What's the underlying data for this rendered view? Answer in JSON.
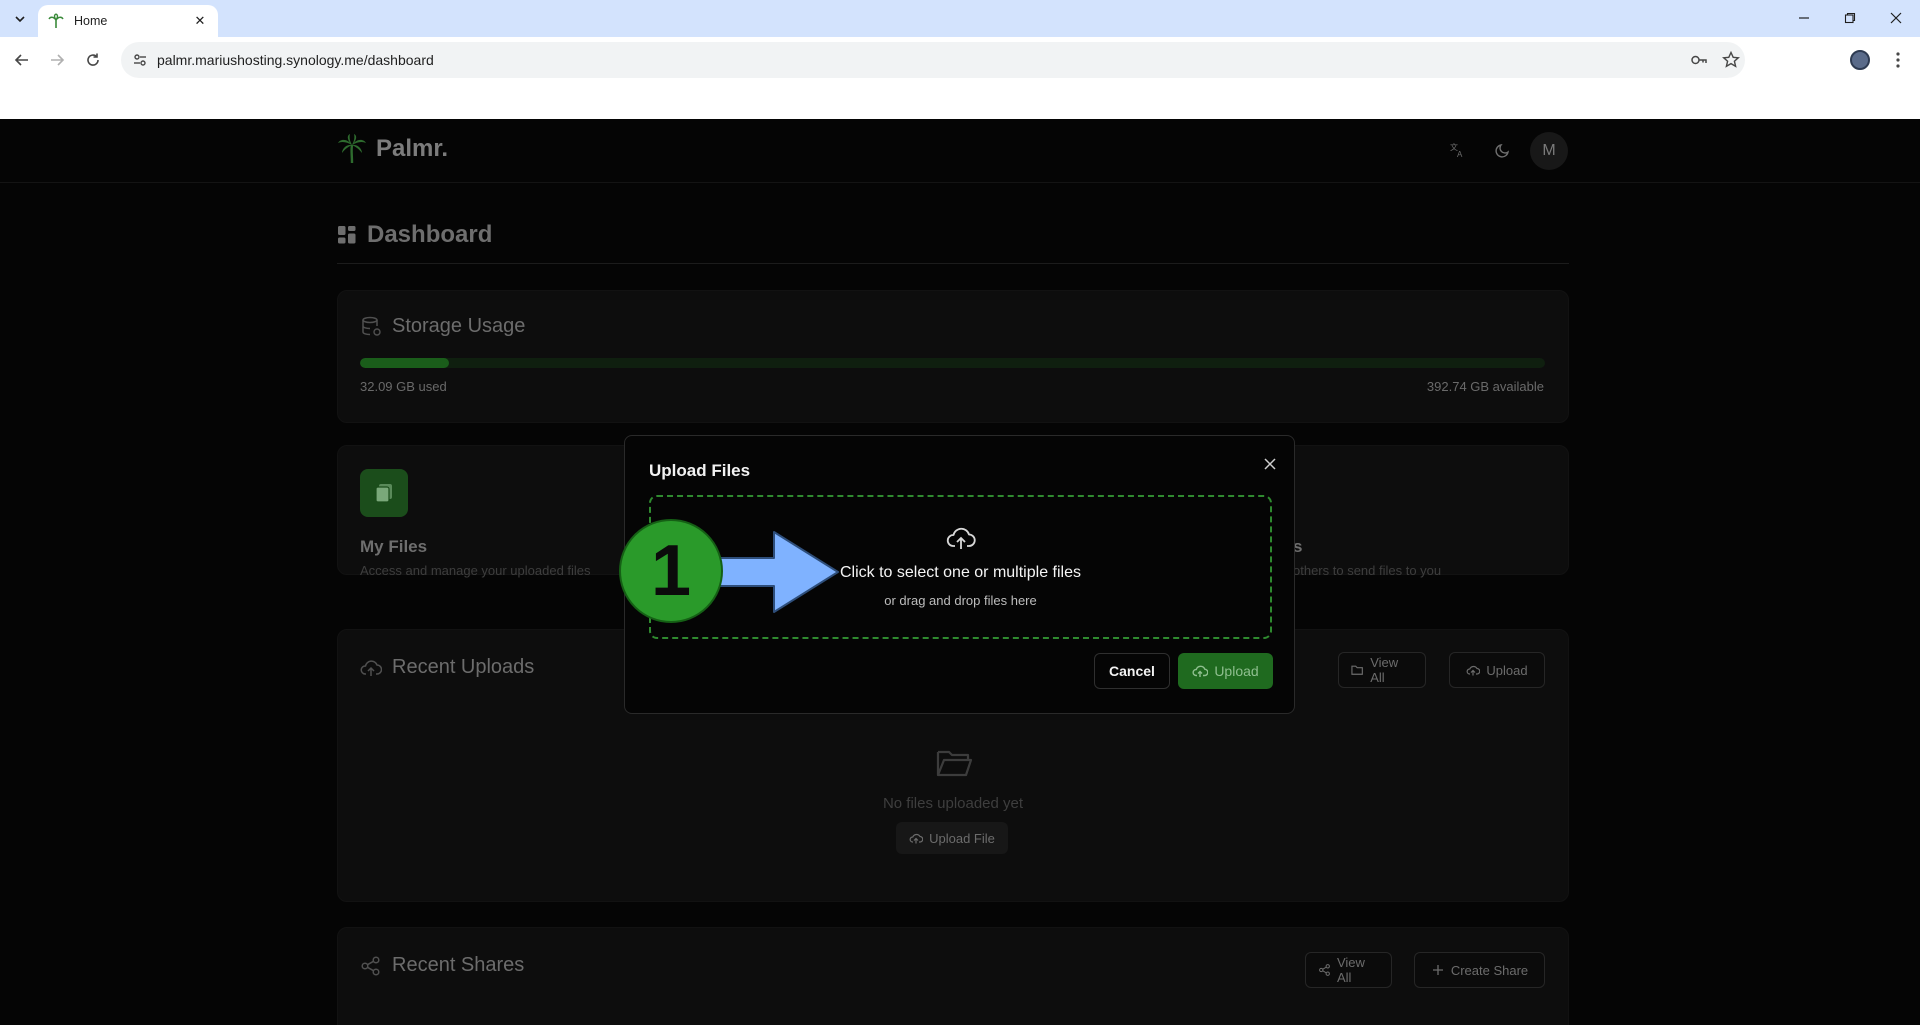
{
  "browser": {
    "tab_title": "Home",
    "url": "palmr.mariushosting.synology.me/dashboard"
  },
  "header": {
    "app_name": "Palmr.",
    "avatar_initial": "M"
  },
  "dashboard": {
    "title": "Dashboard"
  },
  "storage": {
    "title": "Storage Usage",
    "used_label": "32.09 GB used",
    "available_label": "392.74 GB available",
    "used_fraction": 0.0755
  },
  "quick_access": {
    "my_files_title": "My Files",
    "my_files_desc": "Access and manage your uploaded files",
    "right_title_fragment": "s",
    "right_desc_fragment": "others to send files to you"
  },
  "recent_uploads": {
    "title": "Recent Uploads",
    "view_all_label": "View All",
    "upload_label": "Upload",
    "empty_text": "No files uploaded yet",
    "upload_file_label": "Upload File"
  },
  "recent_shares": {
    "title": "Recent Shares",
    "view_all_label": "View All",
    "create_share_label": "Create Share"
  },
  "modal": {
    "title": "Upload Files",
    "dropzone_primary": "Click to select one or multiple files",
    "dropzone_secondary": "or drag and drop files here",
    "cancel_label": "Cancel",
    "upload_label": "Upload"
  },
  "annotation": {
    "step_number": "1"
  },
  "colors": {
    "accent_green": "#1f6a1f",
    "annotation_green": "#2a9a2a",
    "annotation_arrow": "#7fb2ff"
  }
}
